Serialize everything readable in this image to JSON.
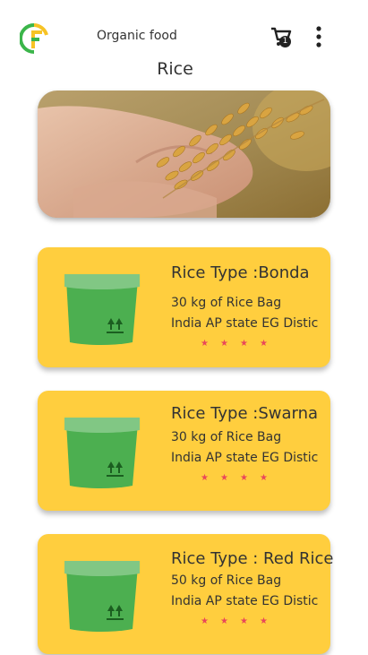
{
  "header": {
    "app_name": "Organic food",
    "cart_count": "1",
    "logo_icon": "leaf-f-logo-icon",
    "cart_icon": "shopping-cart-icon",
    "menu_icon": "more-vertical-icon"
  },
  "page_title": "Rice",
  "hero": {
    "image": "hand-holding-rice-grain-photo"
  },
  "products": [
    {
      "title": "Rice Type :Bonda",
      "weight": "30 kg of Rice Bag",
      "origin": "India AP state EG Distic",
      "rating": 4
    },
    {
      "title": "Rice Type :Swarna",
      "weight": "30 kg of Rice Bag",
      "origin": "India AP state EG Distic",
      "rating": 4
    },
    {
      "title": "Rice Type : Red Rice",
      "weight": "50 kg of Rice Bag",
      "origin": "India AP state EG Distic",
      "rating": 4
    }
  ],
  "colors": {
    "card": "#FFCE3E",
    "bag": "#4CAF50",
    "star": "#E9475A",
    "logo_green": "#3BB54A",
    "logo_yellow": "#F7C325"
  }
}
